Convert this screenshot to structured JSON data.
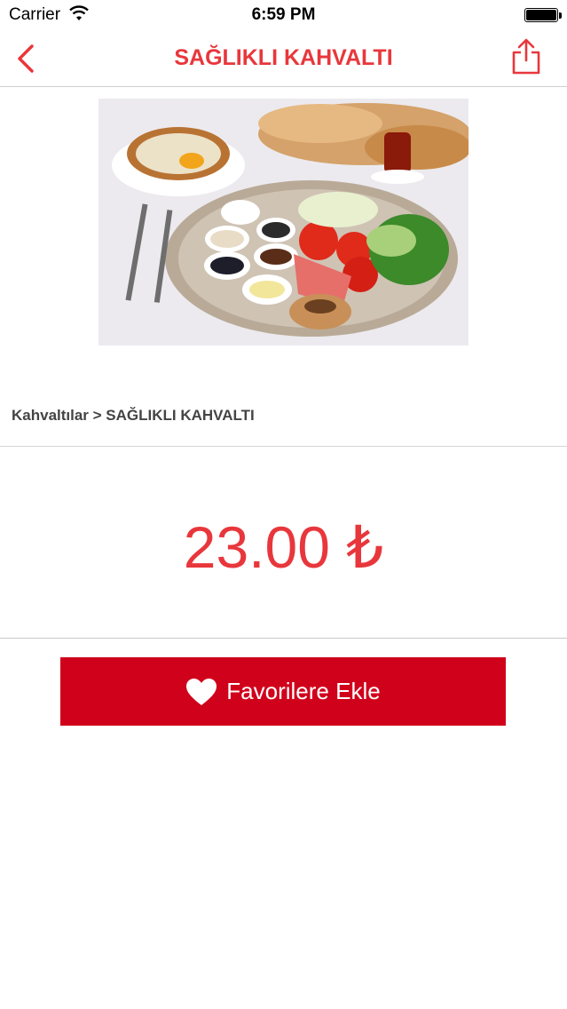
{
  "status_bar": {
    "carrier": "Carrier",
    "time": "6:59 PM"
  },
  "nav": {
    "title": "SAĞLIKLI KAHVALTI",
    "back_icon": "chevron-left-icon",
    "share_icon": "share-icon"
  },
  "product": {
    "breadcrumb": "Kahvaltılar > SAĞLIKLI KAHVALTI",
    "price": "23.00 ₺"
  },
  "actions": {
    "favorite_label": "Favorilere Ekle",
    "favorite_icon": "heart-icon"
  },
  "colors": {
    "accent": "#e8373c",
    "button": "#d0021b"
  }
}
